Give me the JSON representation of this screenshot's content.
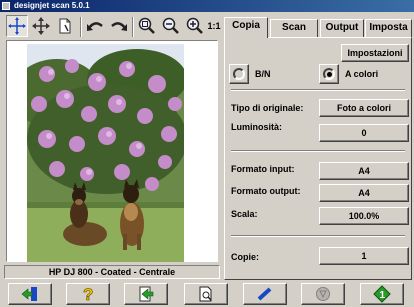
{
  "window": {
    "title": "designjet scan 5.0.1"
  },
  "toolbar": {
    "tools": [
      {
        "name": "select-crosshair-icon",
        "pressed": true
      },
      {
        "name": "move-icon",
        "pressed": false
      },
      {
        "name": "page-icon",
        "pressed": false
      },
      {
        "name": "undo-icon",
        "pressed": false
      },
      {
        "name": "redo-icon",
        "pressed": false
      },
      {
        "name": "zoom-to-selection-icon",
        "pressed": false
      },
      {
        "name": "zoom-out-icon",
        "pressed": false
      },
      {
        "name": "zoom-in-icon",
        "pressed": false
      },
      {
        "name": "actual-size-icon",
        "pressed": false
      }
    ],
    "actual_size_label": "1:1"
  },
  "preview": {
    "status": "HP DJ 800 - Coated - Centrale"
  },
  "tabs": [
    {
      "label": "Copia",
      "active": true
    },
    {
      "label": "Scan",
      "active": false
    },
    {
      "label": "Output",
      "active": false
    },
    {
      "label": "Imposta",
      "active": false
    }
  ],
  "copy_panel": {
    "settings_button": "Impostazioni",
    "color_mode": {
      "bw_label": "B/N",
      "color_label": "A colori",
      "selected": "color"
    },
    "original_type": {
      "label": "Tipo di originale:",
      "value": "Foto a colori"
    },
    "brightness": {
      "label": "Luminosità:",
      "value": "0"
    },
    "input_format": {
      "label": "Formato input:",
      "value": "A4"
    },
    "output_format": {
      "label": "Formato output:",
      "value": "A4"
    },
    "scale": {
      "label": "Scala:",
      "value": "100.0%"
    },
    "copies": {
      "label": "Copie:",
      "value": "1"
    }
  },
  "bottom_toolbar": {
    "buttons": [
      "exit-icon",
      "help-icon",
      "load-scan-icon",
      "preview-page-icon",
      "line-tool-icon",
      "stop-icon",
      "copy-start-icon"
    ]
  },
  "colors": {
    "title_bar": "#0a246a",
    "window_bg": "#d4d0c8",
    "icon_blue": "#1848c8",
    "icon_green": "#2a9a2a",
    "help_yellow": "#f0d000"
  }
}
